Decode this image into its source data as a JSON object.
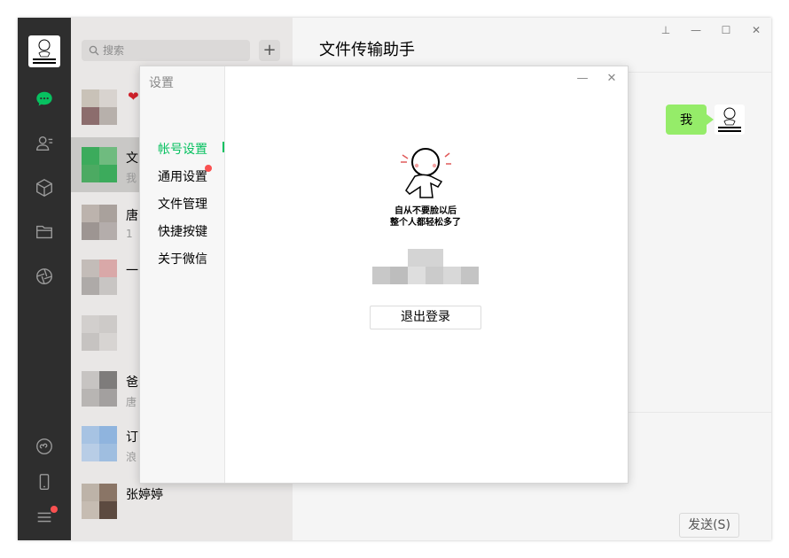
{
  "search": {
    "placeholder": "搜索"
  },
  "chat_list": [
    {
      "name": "",
      "preview": ""
    },
    {
      "name": "文",
      "preview": "我"
    },
    {
      "name": "唐",
      "preview": "1"
    },
    {
      "name": "一",
      "preview": ""
    },
    {
      "name": "",
      "preview": ""
    },
    {
      "name": "爸",
      "preview": "唐"
    },
    {
      "name": "订",
      "preview": "浪"
    },
    {
      "name": "张婷婷",
      "preview": ""
    }
  ],
  "chat": {
    "title": "文件传输助手",
    "message": "我",
    "send_label": "发送(S)"
  },
  "settings": {
    "title": "设置",
    "menu": [
      "帐号设置",
      "通用设置",
      "文件管理",
      "快捷按键",
      "关于微信"
    ],
    "profile_caption": [
      "自从不要脸以后",
      "整个人都轻松多了"
    ],
    "logout_label": "退出登录"
  },
  "window_controls": {
    "pin": "⊥",
    "minimize": "—",
    "maximize": "☐",
    "close": "✕"
  },
  "colors": {
    "accent_green": "#07c160",
    "bubble_green": "#95ec69",
    "nav_bg": "#2e2e2e",
    "badge_red": "#fa5151"
  }
}
